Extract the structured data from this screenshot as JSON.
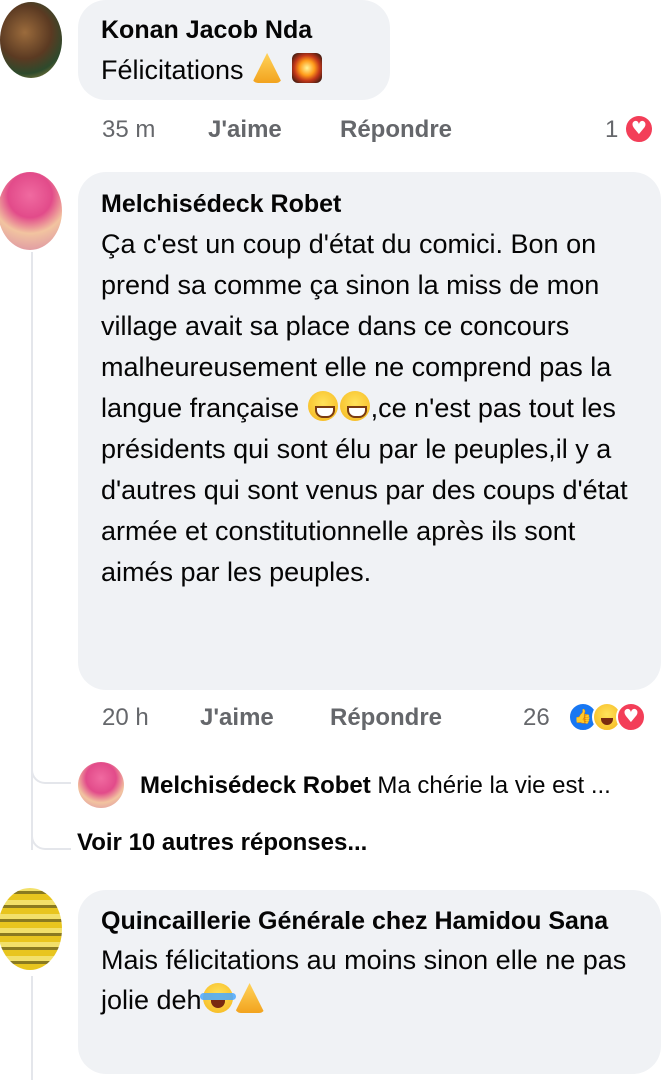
{
  "comments": [
    {
      "author": "Konan Jacob Nda",
      "text": "Félicitations",
      "emojis": [
        "folded-hands",
        "fireworks"
      ],
      "time": "35 m",
      "like_label": "J'aime",
      "reply_label": "Répondre",
      "reaction_count": "1",
      "reactions": [
        "heart"
      ]
    },
    {
      "author": "Melchisédeck Robet",
      "text_part1": "Ça c'est un coup d'état  du comici. Bon on prend sa comme ça sinon la miss de mon village avait sa place dans ce concours malheureusement elle ne comprend pas la langue française ",
      "text_part2": ",ce n'est pas tout les présidents qui sont élu par le peuples,il y a d'autres qui sont venus par des coups d'état armée et constitutionnelle après ils sont aimés par les peuples.",
      "emojis": [
        "grinning-face",
        "grinning-face"
      ],
      "time": "20 h",
      "like_label": "J'aime",
      "reply_label": "Répondre",
      "reaction_count": "26",
      "reactions": [
        "like",
        "haha",
        "heart"
      ],
      "reply_preview": {
        "author": "Melchisédeck Robet",
        "text": "Ma chérie la vie est ..."
      },
      "more_replies": "Voir 10 autres réponses..."
    },
    {
      "author": "Quincaillerie Générale chez Hamidou Sana",
      "text": "Mais félicitations au moins sinon elle ne pas jolie deh",
      "emojis": [
        "tears-of-joy",
        "folded-hands"
      ]
    }
  ],
  "colors": {
    "bubble": "#f0f2f5",
    "secondary_text": "#65676b",
    "thread_line": "#e4e6eb",
    "like_blue": "#1877f2",
    "heart_red": "#f33e58"
  }
}
